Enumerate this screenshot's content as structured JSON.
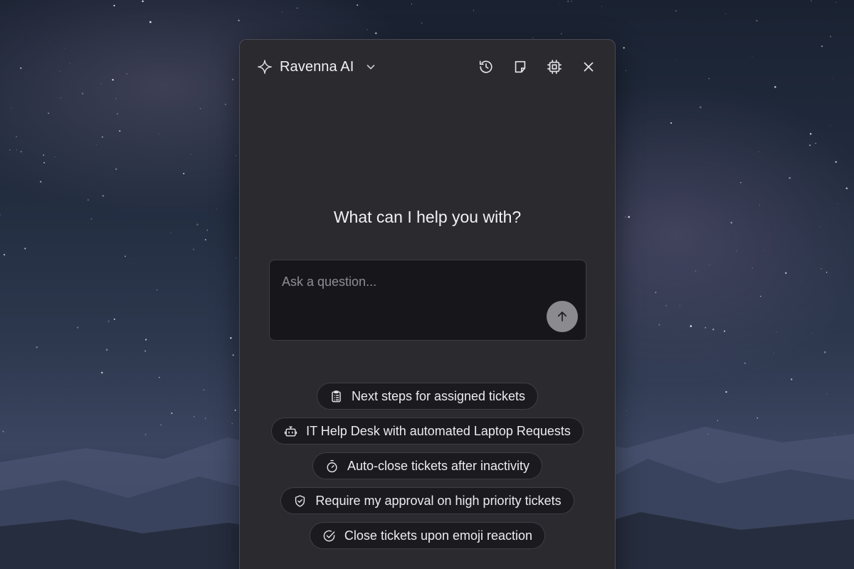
{
  "header": {
    "brand_name": "Ravenna AI",
    "icons": [
      "sparkle-icon",
      "chevron-down-icon",
      "history-icon",
      "note-icon",
      "chip-icon",
      "close-icon"
    ]
  },
  "main": {
    "title": "What can I help you with?",
    "ask": {
      "placeholder": "Ask a question...",
      "value": ""
    }
  },
  "suggestions": [
    {
      "label": "Next steps for assigned tickets",
      "icon": "clipboard-list-icon"
    },
    {
      "label": "IT Help Desk with automated Laptop Requests",
      "icon": "bot-icon"
    },
    {
      "label": "Auto-close tickets after inactivity",
      "icon": "timer-icon"
    },
    {
      "label": "Require my approval on high priority tickets",
      "icon": "shield-check-icon"
    },
    {
      "label": "Close tickets upon emoji reaction",
      "icon": "check-circle-icon"
    }
  ],
  "colors": {
    "panel": "#2a2a2f",
    "input": "#17171b",
    "chip": "#1b1b1f",
    "send_button": "#8a8a8f"
  }
}
